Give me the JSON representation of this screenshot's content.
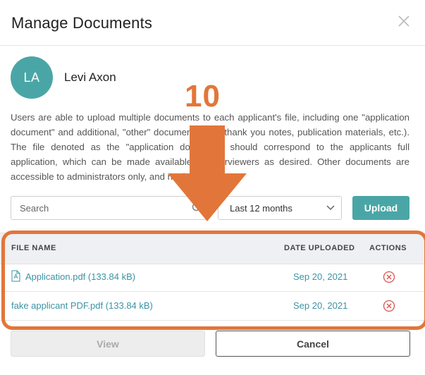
{
  "modal": {
    "title": "Manage Documents"
  },
  "applicant": {
    "initials": "LA",
    "name": "Levi Axon"
  },
  "description": "Users are able to upload multiple documents to each applicant's file, including one \"application document\" and additional, \"other\" documents (e.g. thank you notes, publication materials, etc.). The file denoted as the \"application document\" should correspond to the applicants full application, which can be made available to interviewers as desired. Other documents are accessible to administrators only, and not interviewers.",
  "search": {
    "placeholder": "Search",
    "value": ""
  },
  "filter": {
    "selected": "Last 12 months"
  },
  "toolbar": {
    "upload_label": "Upload"
  },
  "table": {
    "columns": [
      "FILE NAME",
      "DATE UPLOADED",
      "ACTIONS"
    ],
    "rows": [
      {
        "file": "Application.pdf (133.84 kB)",
        "date": "Sep 20, 2021",
        "icon": "pdf-file-icon"
      },
      {
        "file": "fake applicant PDF.pdf (133.84 kB)",
        "date": "Sep 20, 2021",
        "icon": ""
      }
    ]
  },
  "annotation": {
    "number": "10",
    "color": "#e2763a"
  },
  "footer": {
    "view_label": "View",
    "cancel_label": "Cancel"
  },
  "colors": {
    "accent": "#4aa6a6",
    "link": "#3b93a3",
    "delete": "#d9534f"
  }
}
